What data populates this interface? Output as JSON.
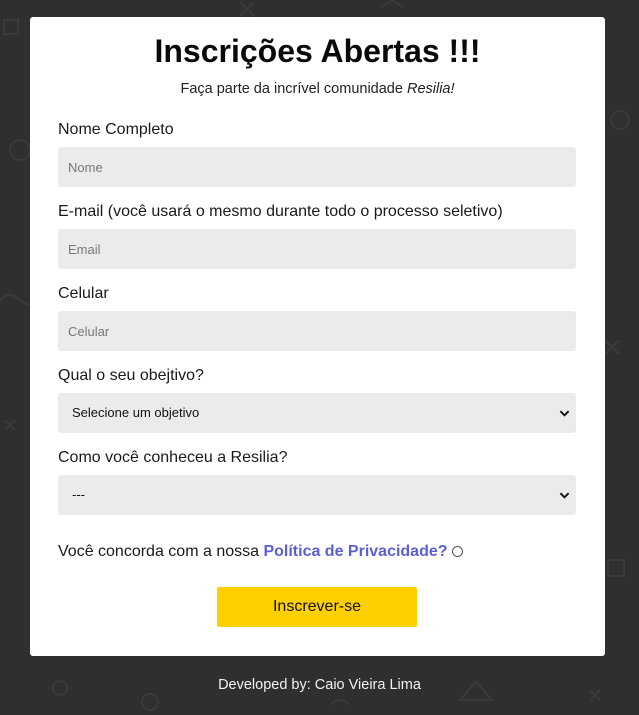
{
  "form": {
    "title": "Inscrições Abertas !!!",
    "subtitle_prefix": "Faça parte da incrível comunidade ",
    "subtitle_brand": "Resilia!",
    "name_label": "Nome Completo",
    "name_placeholder": "Nome",
    "email_label": "E-mail (você usará o mesmo durante todo o processo seletivo)",
    "email_placeholder": "Email",
    "phone_label": "Celular",
    "phone_placeholder": "Celular",
    "objective_label": "Qual o seu obejtivo?",
    "objective_selected": "Selecione um objetivo",
    "source_label": "Como você conheceu a Resilia?",
    "source_selected": "---",
    "privacy_prefix": "Você concorda com a nossa ",
    "privacy_link": "Política de Privacidade?",
    "submit_label": "Inscrever-se"
  },
  "footer": {
    "text": "Developed by: Caio Vieira Lima"
  },
  "colors": {
    "background": "#2f2f2f",
    "card": "#ffffff",
    "input_bg": "#ebebeb",
    "button": "#ffd000",
    "link": "#5b5fd6"
  },
  "icons": {
    "select_arrow": "chevron-down-icon"
  }
}
